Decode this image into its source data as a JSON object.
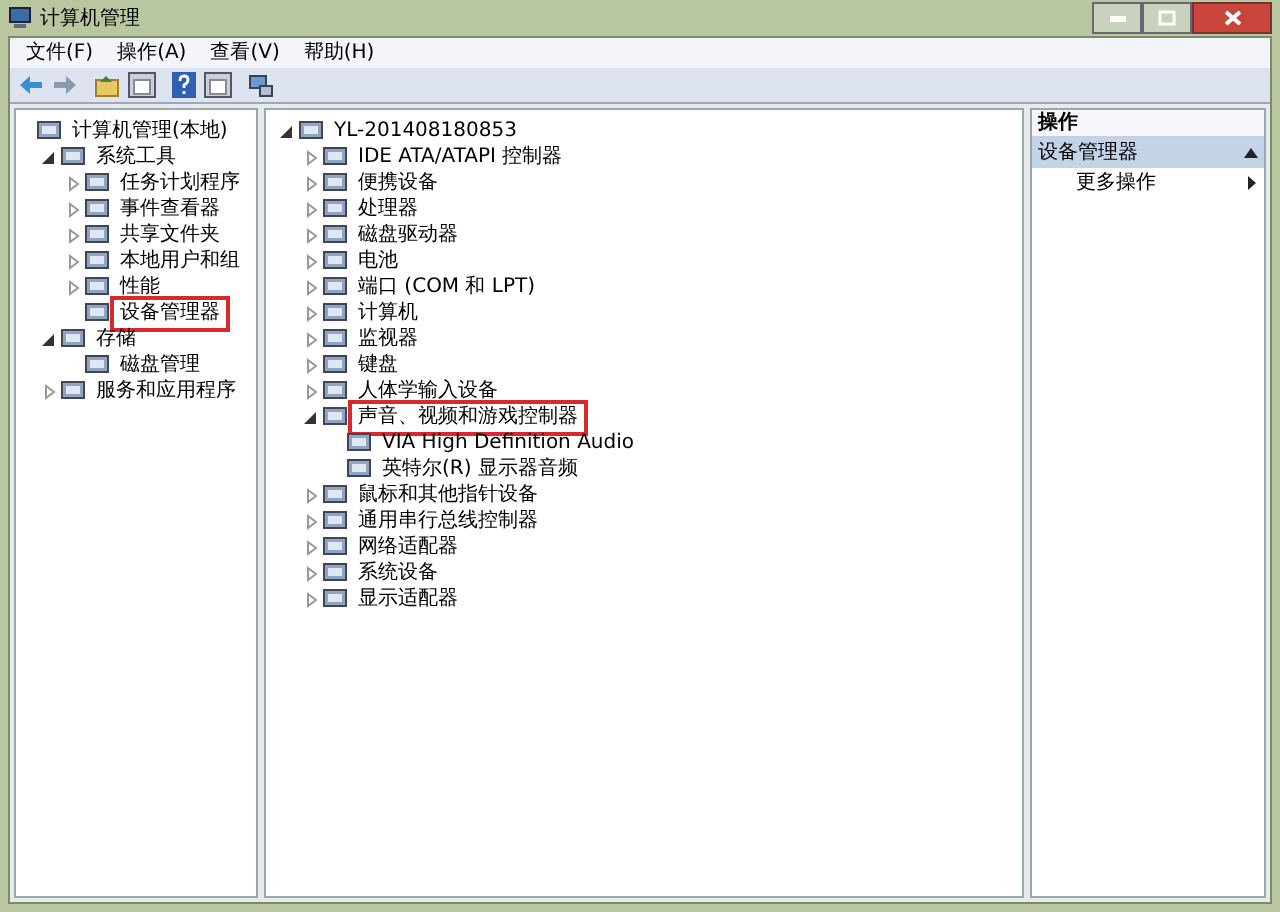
{
  "window": {
    "title": "计算机管理"
  },
  "menu": [
    {
      "label": "文件(F)"
    },
    {
      "label": "操作(A)"
    },
    {
      "label": "查看(V)"
    },
    {
      "label": "帮助(H)"
    }
  ],
  "left_tree": [
    {
      "label": "计算机管理(本地)",
      "outlined": false,
      "children": [
        {
          "label": "系统工具",
          "expanded": true,
          "outlined": false,
          "children": [
            {
              "label": "任务计划程序",
              "expanded": false,
              "outlined": false
            },
            {
              "label": "事件查看器",
              "expanded": false,
              "outlined": false
            },
            {
              "label": "共享文件夹",
              "expanded": false,
              "outlined": false
            },
            {
              "label": "本地用户和组",
              "expanded": false,
              "outlined": false
            },
            {
              "label": "性能",
              "expanded": false,
              "outlined": false
            },
            {
              "label": "设备管理器",
              "outlined": true
            }
          ]
        },
        {
          "label": "存储",
          "expanded": true,
          "outlined": false,
          "children": [
            {
              "label": "磁盘管理",
              "outlined": false
            }
          ]
        },
        {
          "label": "服务和应用程序",
          "expanded": false,
          "outlined": false
        }
      ]
    }
  ],
  "device_tree": [
    {
      "label": "YL-201408180853",
      "expanded": true,
      "children": [
        {
          "label": "IDE ATA/ATAPI 控制器",
          "expanded": false,
          "outlined": false
        },
        {
          "label": "便携设备",
          "expanded": false,
          "outlined": false
        },
        {
          "label": "处理器",
          "expanded": false,
          "outlined": false
        },
        {
          "label": "磁盘驱动器",
          "expanded": false,
          "outlined": false
        },
        {
          "label": "电池",
          "expanded": false,
          "outlined": false
        },
        {
          "label": "端口 (COM 和 LPT)",
          "expanded": false,
          "outlined": false
        },
        {
          "label": "计算机",
          "expanded": false,
          "outlined": false
        },
        {
          "label": "监视器",
          "expanded": false,
          "outlined": false
        },
        {
          "label": "键盘",
          "expanded": false,
          "outlined": false
        },
        {
          "label": "人体学输入设备",
          "expanded": false,
          "outlined": false
        },
        {
          "label": "声音、视频和游戏控制器",
          "expanded": true,
          "outlined": true,
          "children": [
            {
              "label": "VIA High Definition Audio",
              "outlined": false
            },
            {
              "label": "英特尔(R) 显示器音频",
              "outlined": false
            }
          ]
        },
        {
          "label": "鼠标和其他指针设备",
          "expanded": false,
          "outlined": false
        },
        {
          "label": "通用串行总线控制器",
          "expanded": false,
          "outlined": false
        },
        {
          "label": "网络适配器",
          "expanded": false,
          "outlined": false
        },
        {
          "label": "系统设备",
          "expanded": false,
          "outlined": false
        },
        {
          "label": "显示适配器",
          "expanded": false,
          "outlined": false
        }
      ]
    }
  ],
  "actions": {
    "title": "操作",
    "section": {
      "label": "设备管理器",
      "expanded": true
    },
    "items": [
      {
        "label": "更多操作"
      }
    ]
  }
}
